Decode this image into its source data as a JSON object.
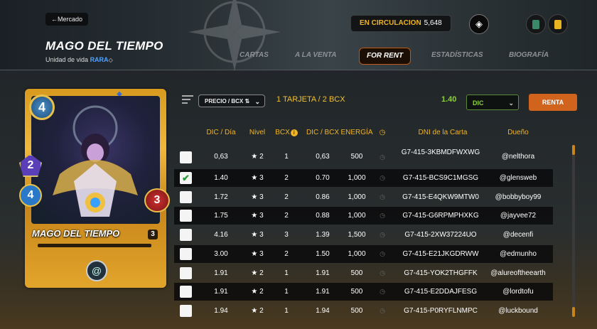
{
  "header": {
    "back_label": "Mercado",
    "title": "MAGO DEL TIEMPO",
    "subtitle_prefix": "Unidad de vida",
    "rarity": "RARA",
    "circulation_label": "EN CIRCULACION",
    "circulation_value": "5,648"
  },
  "tabs": [
    {
      "label": "CARTAS",
      "active": false
    },
    {
      "label": "A LA VENTA",
      "active": false
    },
    {
      "label": "FOR RENT",
      "active": true
    },
    {
      "label": "ESTADÍSTICAS",
      "active": false
    },
    {
      "label": "BIOGRAFÍA",
      "active": false
    }
  ],
  "card": {
    "name": "MAGO DEL TIEMPO",
    "level": "3",
    "mana": "4",
    "speed": "2",
    "magic": "4",
    "health": "3"
  },
  "filters": {
    "sort_label": "PRECIO / BCX",
    "bcx_info": "1 TARJETA / 2 BCX",
    "price": "1.40",
    "currency": "DIC",
    "rent_label": "RENTA"
  },
  "table": {
    "columns": [
      "DIC / Día",
      "Nivel",
      "BCX",
      "DIC / BCX",
      "ENERGÍA",
      "",
      "DNI de la Carta",
      "Dueño"
    ],
    "rows": [
      {
        "checked": false,
        "price": "0,63",
        "level": "2",
        "bcx": "1",
        "per_bcx": "0,63",
        "energy": "500",
        "uid": "G7-415-3KBMDFWXWG",
        "owner": "@nelthora"
      },
      {
        "checked": true,
        "price": "1.40",
        "level": "3",
        "bcx": "2",
        "per_bcx": "0.70",
        "energy": "1,000",
        "uid": "G7-415-BCS9C1MGSG",
        "owner": "@glensweb"
      },
      {
        "checked": false,
        "price": "1.72",
        "level": "3",
        "bcx": "2",
        "per_bcx": "0.86",
        "energy": "1,000",
        "uid": "G7-415-E4QKW9MTW0",
        "owner": "@bobbyboy99"
      },
      {
        "checked": false,
        "price": "1.75",
        "level": "3",
        "bcx": "2",
        "per_bcx": "0.88",
        "energy": "1,000",
        "uid": "G7-415-G6RPMPHXKG",
        "owner": "@jayvee72"
      },
      {
        "checked": false,
        "price": "4.16",
        "level": "3",
        "bcx": "3",
        "per_bcx": "1.39",
        "energy": "1,500",
        "uid": "G7-415-2XW37224UO",
        "owner": "@decenfi"
      },
      {
        "checked": false,
        "price": "3.00",
        "level": "3",
        "bcx": "2",
        "per_bcx": "1.50",
        "energy": "1,000",
        "uid": "G7-415-E21JKGDRWW",
        "owner": "@edmunho"
      },
      {
        "checked": false,
        "price": "1.91",
        "level": "2",
        "bcx": "1",
        "per_bcx": "1.91",
        "energy": "500",
        "uid": "G7-415-YOK2THGFFK",
        "owner": "@alureoftheearth"
      },
      {
        "checked": false,
        "price": "1.91",
        "level": "2",
        "bcx": "1",
        "per_bcx": "1.91",
        "energy": "500",
        "uid": "G7-415-E2DDAJFESG",
        "owner": "@lordtofu"
      },
      {
        "checked": false,
        "price": "1.94",
        "level": "2",
        "bcx": "1",
        "per_bcx": "1.94",
        "energy": "500",
        "uid": "G7-415-P0RYFLNMPC",
        "owner": "@luckbound"
      }
    ]
  },
  "colors": {
    "accent": "#f0b428",
    "rent": "#d0641c",
    "price": "#8dd13a"
  }
}
